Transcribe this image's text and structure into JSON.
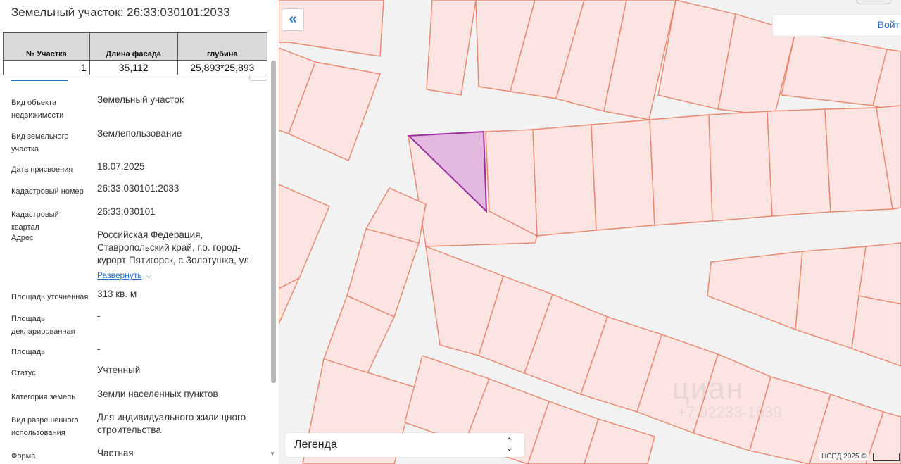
{
  "panel": {
    "title": "Земельный участок: 26:33:030101:2033",
    "overlay_table": {
      "headers": [
        "№ Участка",
        "Длина фасада",
        "глубина"
      ],
      "row": [
        "1",
        "35,112",
        "25,893*25,893"
      ]
    },
    "properties": [
      {
        "label": "Вид объекта недвижимости",
        "value": "Земельный участок"
      },
      {
        "label": "Вид земельного участка",
        "value": "Землепользование"
      },
      {
        "label": "Дата присвоения",
        "value": "18.07.2025"
      },
      {
        "label": "Кадастровый номер",
        "value": "26:33:030101:2033"
      },
      {
        "label": "Кадастровый квартал",
        "value": "26:33:030101"
      },
      {
        "label": "Адрес",
        "value": "Российская Федерация, Ставропольский край, г.о. город-курорт Пятигорск, с Золотушка, ул"
      },
      {
        "label": "Площадь уточненная",
        "value": "313 кв. м"
      },
      {
        "label": "Площадь декларированная",
        "value": "-"
      },
      {
        "label": "Площадь",
        "value": "-"
      },
      {
        "label": "Статус",
        "value": "Учтенный"
      },
      {
        "label": "Категория земель",
        "value": "Земли населенных пунктов"
      },
      {
        "label": "Вид разрешенного использования",
        "value": "Для индивидуального жилищного строительства"
      },
      {
        "label": "Форма собственности",
        "value": "Частная"
      }
    ],
    "expand_link": "Развернуть"
  },
  "map": {
    "collapse_icon": "double-chevron-left-icon",
    "collapse_glyph": "«",
    "login_label": "Войт",
    "legend_label": "Легенда",
    "legend_icon": "up-down-chevron-icon",
    "copyright": "НСПД 2025 ©",
    "watermark": "циан",
    "watermark_phone": "+7 92233-1639"
  },
  "colors": {
    "parcel_fill": "#fbe4e2",
    "parcel_stroke": "#e8866d",
    "selected_fill": "#e3b9df",
    "selected_stroke": "#9c2fa0",
    "link": "#2a6fc9"
  }
}
